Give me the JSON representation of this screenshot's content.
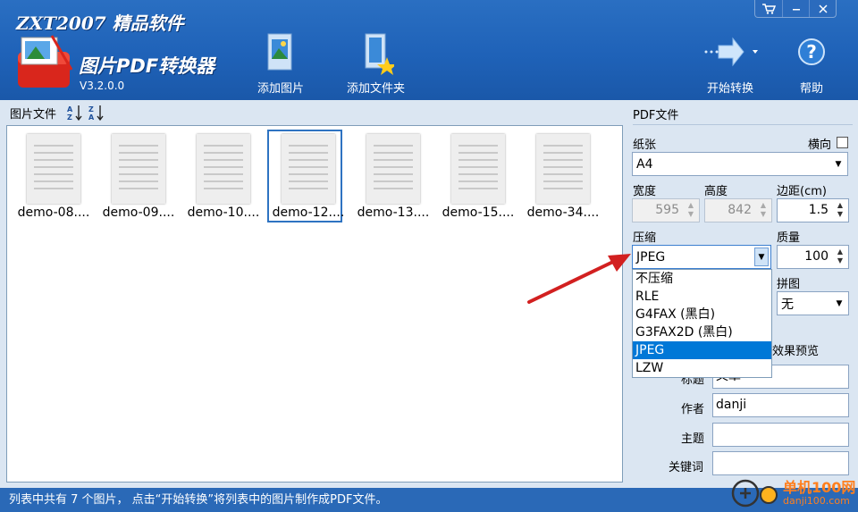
{
  "header": {
    "brand_top": "ZXT2007 精品软件",
    "title": "图片PDF转换器",
    "version": "V3.2.0.0",
    "buttons": {
      "add_image": "添加图片",
      "add_folder": "添加文件夹",
      "start": "开始转换",
      "help": "帮助"
    },
    "window_controls": [
      "cart-icon",
      "minimize-icon",
      "close-icon"
    ]
  },
  "file_panel": {
    "label": "图片文件",
    "sort_icons": [
      "sort-asc-icon",
      "sort-desc-icon"
    ],
    "files": [
      {
        "name": "demo-08....",
        "selected": false
      },
      {
        "name": "demo-09....",
        "selected": false
      },
      {
        "name": "demo-10....",
        "selected": false
      },
      {
        "name": "demo-12....",
        "selected": true
      },
      {
        "name": "demo-13....",
        "selected": false
      },
      {
        "name": "demo-15....",
        "selected": false
      },
      {
        "name": "demo-34....",
        "selected": false
      }
    ]
  },
  "pdf_panel": {
    "title": "PDF文件",
    "paper_label": "纸张",
    "landscape_label": "横向",
    "paper_value": "A4",
    "width_label": "宽度",
    "width_value": "595",
    "height_label": "高度",
    "height_value": "842",
    "margin_label": "边距(cm)",
    "margin_value": "1.5",
    "compression_label": "压缩",
    "compression_value": "JPEG",
    "quality_label": "质量",
    "quality_value": "100",
    "mosaic_label": "拼图",
    "mosaic_value": "无",
    "preview_label_partial": "效果预览",
    "title_field_label": "标题",
    "title_field_value": "文章",
    "author_label": "作者",
    "author_value": "danji",
    "subject_label": "主题",
    "subject_value": "",
    "keywords_label": "关键词",
    "keywords_value": "",
    "compression_options": [
      "不压缩",
      "RLE",
      "G4FAX (黑白)",
      "G3FAX2D (黑白)",
      "JPEG",
      "LZW"
    ],
    "compression_selected_index": 4
  },
  "status": {
    "text": "列表中共有 7 个图片， 点击“开始转换”将列表中的图片制作成PDF文件。"
  },
  "watermark": {
    "line1": "单机100网",
    "line2": "danji100.com"
  },
  "colors": {
    "header_blue": "#1f62b8",
    "selection_blue": "#0078d7",
    "arrow_red": "#d22020",
    "watermark_orange": "#ff7f1e"
  }
}
